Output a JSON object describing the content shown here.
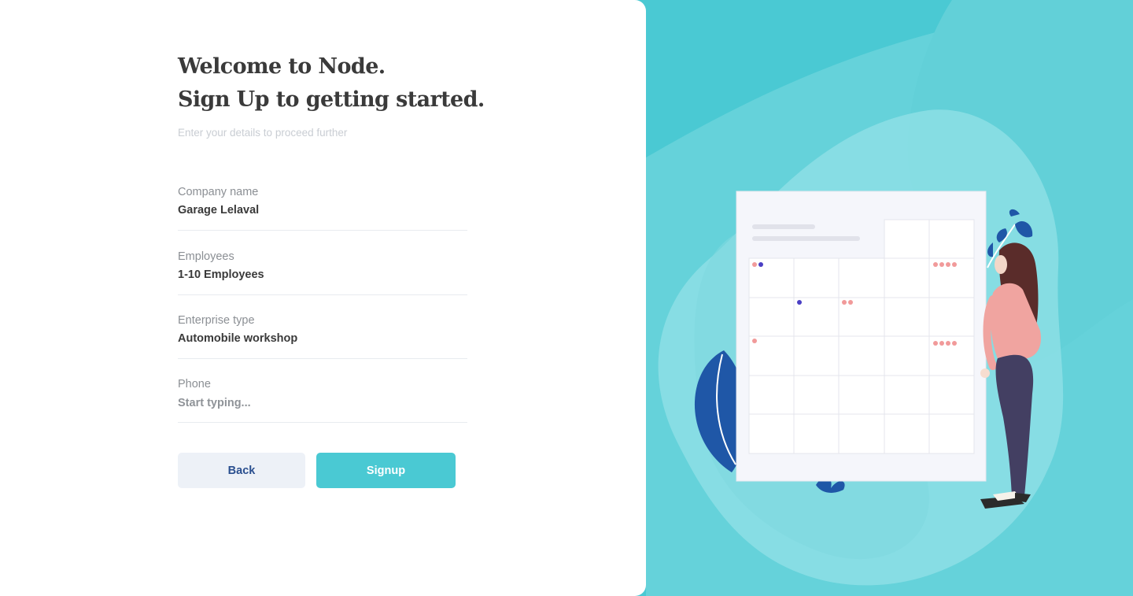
{
  "heading": {
    "line1": "Welcome to Node.",
    "line2": "Sign Up to getting started."
  },
  "subtitle": "Enter your details to proceed further",
  "fields": [
    {
      "label": "Company name",
      "value": "Garage Lelaval"
    },
    {
      "label": "Employees",
      "value": "1-10 Employees"
    },
    {
      "label": "Enterprise type",
      "value": "Automobile workshop"
    },
    {
      "label": "Phone",
      "value": "",
      "placeholder": "Start typing..."
    }
  ],
  "buttons": {
    "back": "Back",
    "signup": "Signup"
  },
  "colors": {
    "accent": "#4ac9d3",
    "text": "#3a3a3a",
    "label": "#8b8f94",
    "back_button_bg": "#edf1f7",
    "back_button_text": "#2a4f8f"
  },
  "illustration": {
    "subject": "woman-standing-by-calendar-board"
  }
}
